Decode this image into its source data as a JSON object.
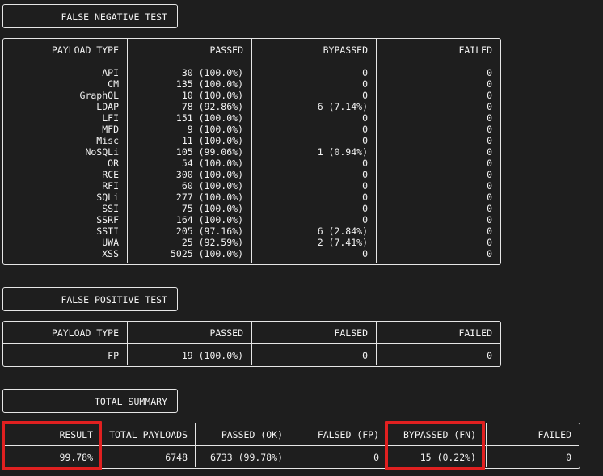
{
  "fn_test": {
    "title": "FALSE NEGATIVE TEST",
    "headers": [
      "PAYLOAD TYPE",
      "PASSED",
      "BYPASSED",
      "FAILED"
    ],
    "rows": [
      [
        "API",
        "30 (100.0%)",
        "0",
        "0"
      ],
      [
        "CM",
        "135 (100.0%)",
        "0",
        "0"
      ],
      [
        "GraphQL",
        "10 (100.0%)",
        "0",
        "0"
      ],
      [
        "LDAP",
        "78 (92.86%)",
        "6 (7.14%)",
        "0"
      ],
      [
        "LFI",
        "151 (100.0%)",
        "0",
        "0"
      ],
      [
        "MFD",
        "9 (100.0%)",
        "0",
        "0"
      ],
      [
        "Misc",
        "11 (100.0%)",
        "0",
        "0"
      ],
      [
        "NoSQLi",
        "105 (99.06%)",
        "1 (0.94%)",
        "0"
      ],
      [
        "OR",
        "54 (100.0%)",
        "0",
        "0"
      ],
      [
        "RCE",
        "300 (100.0%)",
        "0",
        "0"
      ],
      [
        "RFI",
        "60 (100.0%)",
        "0",
        "0"
      ],
      [
        "SQLi",
        "277 (100.0%)",
        "0",
        "0"
      ],
      [
        "SSI",
        "75 (100.0%)",
        "0",
        "0"
      ],
      [
        "SSRF",
        "164 (100.0%)",
        "0",
        "0"
      ],
      [
        "SSTI",
        "205 (97.16%)",
        "6 (2.84%)",
        "0"
      ],
      [
        "UWA",
        "25 (92.59%)",
        "2 (7.41%)",
        "0"
      ],
      [
        "XSS",
        "5025 (100.0%)",
        "0",
        "0"
      ]
    ]
  },
  "fp_test": {
    "title": "FALSE POSITIVE TEST",
    "headers": [
      "PAYLOAD TYPE",
      "PASSED",
      "FALSED",
      "FAILED"
    ],
    "rows": [
      [
        "FP",
        "19 (100.0%)",
        "0",
        "0"
      ]
    ]
  },
  "summary": {
    "title": "TOTAL SUMMARY",
    "headers": [
      "RESULT",
      "TOTAL PAYLOADS",
      "PASSED (OK)",
      "FALSED (FP)",
      "BYPASSED (FN)",
      "FAILED"
    ],
    "values": [
      "99.78%",
      "6748",
      "6733 (99.78%)",
      "0",
      "15 (0.22%)",
      "0"
    ]
  },
  "colors": {
    "background": "#1e1e1e",
    "text": "#f2f2f2",
    "border": "#e6e6e6",
    "highlight": "#e02020"
  }
}
